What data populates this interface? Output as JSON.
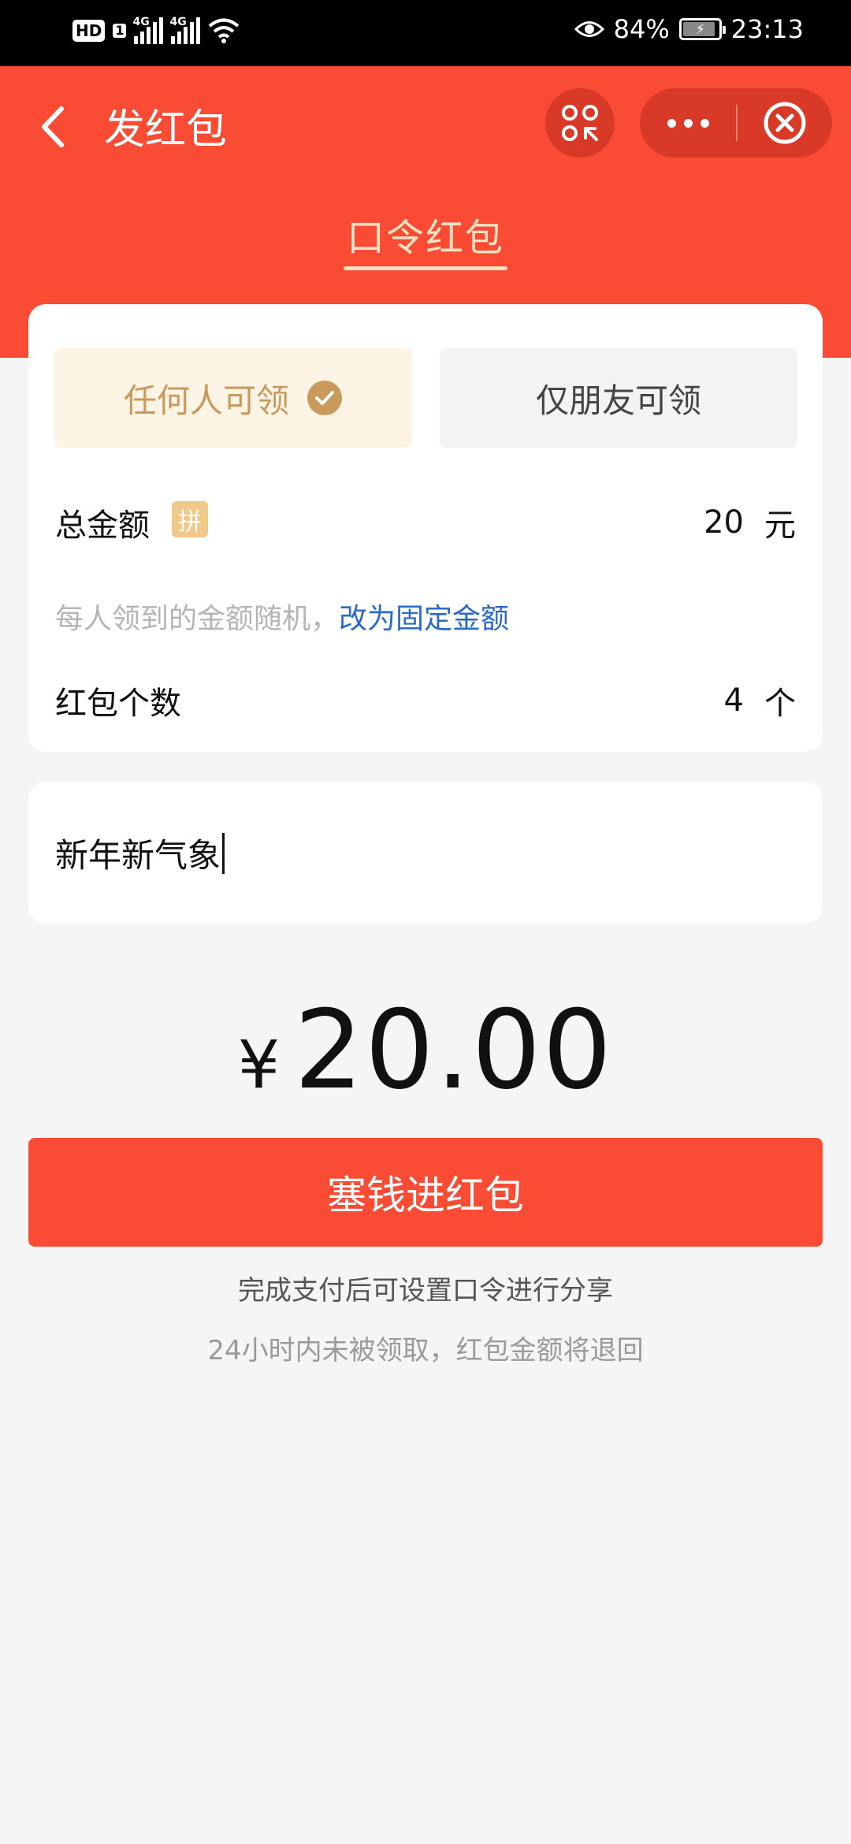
{
  "status_bar": {
    "hd": "HD",
    "sim": "1",
    "net1": "4G",
    "net2": "4G",
    "battery": "84%",
    "time": "23:13"
  },
  "header": {
    "title": "发红包",
    "tab": "口令红包"
  },
  "options": {
    "anyone": "任何人可领",
    "friends_only": "仅朋友可领"
  },
  "form": {
    "total_label": "总金额",
    "pin_badge": "拼",
    "total_value": "20",
    "total_unit": "元",
    "hint_text": "每人领到的金额随机，",
    "hint_link": "改为固定金额",
    "count_label": "红包个数",
    "count_value": "4",
    "count_unit": "个"
  },
  "message": {
    "value": "新年新气象"
  },
  "amount": {
    "symbol": "¥",
    "value": "20.00"
  },
  "submit_label": "塞钱进红包",
  "notes": {
    "line1": "完成支付后可设置口令进行分享",
    "line2": "24小时内未被领取，红包金额将退回"
  },
  "colors": {
    "brand_red": "#fa4b35",
    "gold": "#c99a5c",
    "link_blue": "#2a6bc9"
  }
}
